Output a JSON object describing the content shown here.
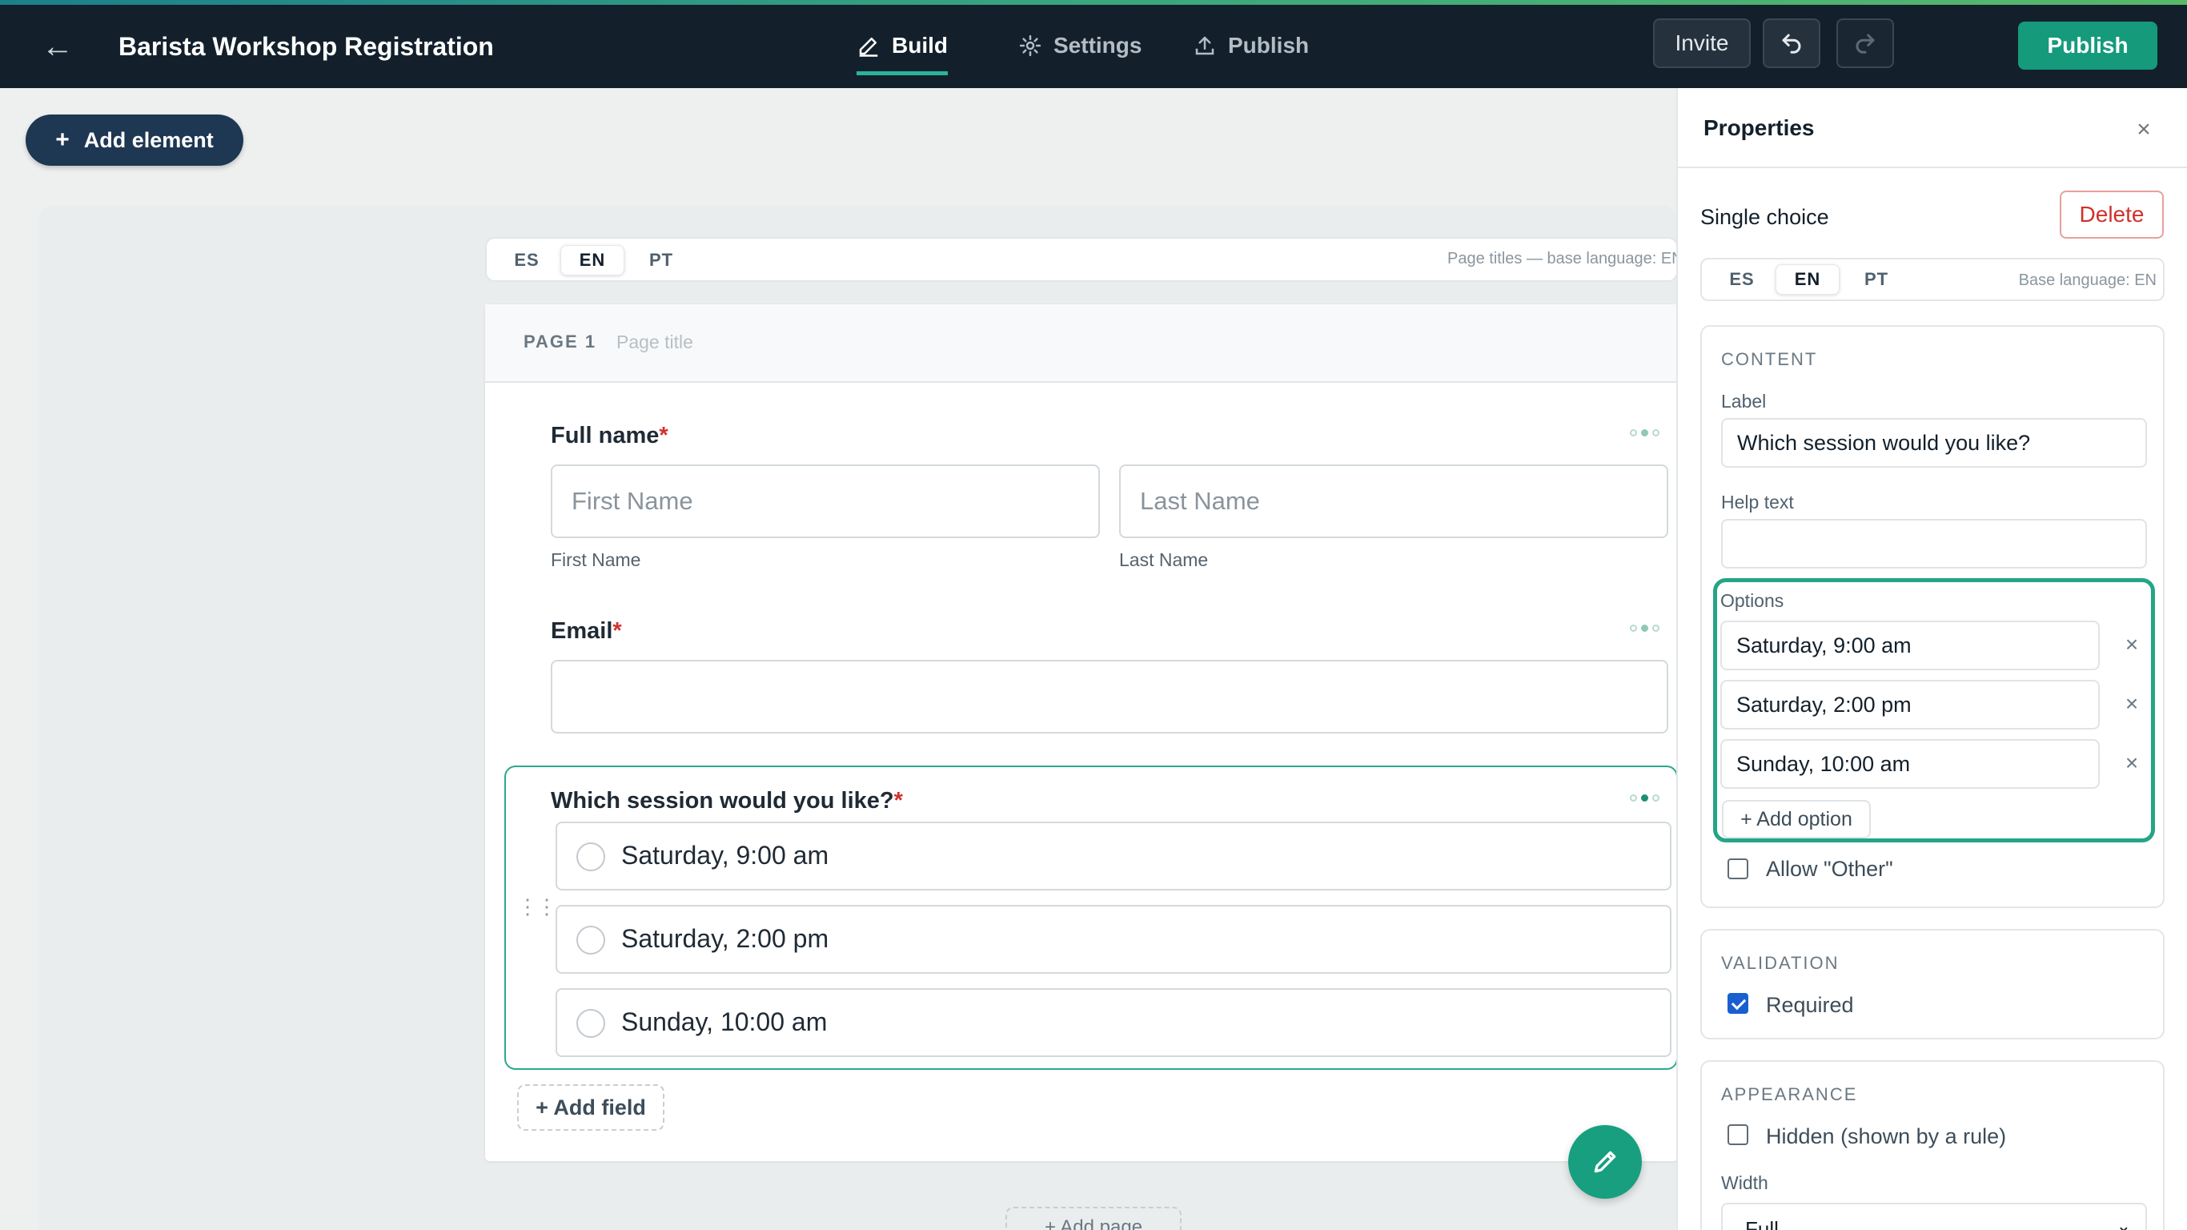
{
  "header": {
    "title": "Barista Workshop Registration",
    "tabs": [
      {
        "label": "Build",
        "active": true
      },
      {
        "label": "Settings"
      },
      {
        "label": "Publish"
      }
    ],
    "invite_label": "Invite",
    "publish_label": "Publish",
    "accent": "#159a7c"
  },
  "toolbar": {
    "add_element_label": "Add element"
  },
  "languages": {
    "items": [
      "ES",
      "EN",
      "PT"
    ],
    "active": "EN",
    "page_note": "Page titles — base language: EN"
  },
  "page": {
    "number_label": "PAGE 1",
    "title_placeholder": "Page title",
    "fields": {
      "fullname": {
        "label": "Full name",
        "first_placeholder": "First Name",
        "last_placeholder": "Last Name",
        "first_sublabel": "First Name",
        "last_sublabel": "Last Name"
      },
      "email": {
        "label": "Email"
      },
      "session": {
        "label": "Which session would you like?",
        "options": [
          "Saturday, 9:00 am",
          "Saturday, 2:00 pm",
          "Sunday, 10:00 am"
        ]
      }
    },
    "required_mark": "*",
    "add_field_label": "+ Add field",
    "add_page_label": "+ Add page"
  },
  "properties": {
    "title": "Properties",
    "element_type": "Single choice",
    "delete_label": "Delete",
    "base_language_note": "Base language: EN",
    "content": {
      "header": "CONTENT",
      "label_caption": "Label",
      "label_value": "Which session would you like?",
      "help_caption": "Help text",
      "help_value": "",
      "options_caption": "Options",
      "options": [
        "Saturday, 9:00 am",
        "Saturday, 2:00 pm",
        "Sunday, 10:00 am"
      ],
      "add_option_label": "+ Add option",
      "allow_other_label": "Allow \"Other\"",
      "allow_other": false
    },
    "validation": {
      "header": "VALIDATION",
      "required_label": "Required",
      "required": true
    },
    "appearance": {
      "header": "APPEARANCE",
      "hidden_label": "Hidden (shown by a rule)",
      "hidden": false,
      "width_caption": "Width",
      "width_value": "Full"
    }
  }
}
